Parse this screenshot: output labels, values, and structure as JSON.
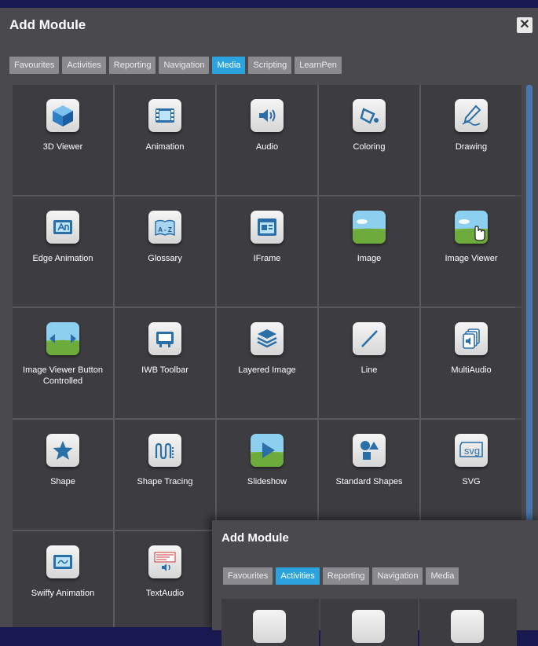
{
  "dialog": {
    "title": "Add Module",
    "close_symbol": "✕",
    "tabs": [
      {
        "label": "Favourites",
        "active": false
      },
      {
        "label": "Activities",
        "active": false
      },
      {
        "label": "Reporting",
        "active": false
      },
      {
        "label": "Navigation",
        "active": false
      },
      {
        "label": "Media",
        "active": true
      },
      {
        "label": "Scripting",
        "active": false
      },
      {
        "label": "LearnPen",
        "active": false
      }
    ],
    "modules": [
      {
        "label": "3D Viewer",
        "icon": "cube-icon"
      },
      {
        "label": "Animation",
        "icon": "film-icon"
      },
      {
        "label": "Audio",
        "icon": "speaker-icon"
      },
      {
        "label": "Coloring",
        "icon": "paint-bucket-icon"
      },
      {
        "label": "Drawing",
        "icon": "pen-icon"
      },
      {
        "label": "Edge Animation",
        "icon": "edge-animation-icon"
      },
      {
        "label": "Glossary",
        "icon": "book-az-icon"
      },
      {
        "label": "IFrame",
        "icon": "iframe-icon"
      },
      {
        "label": "Image",
        "icon": "landscape-icon"
      },
      {
        "label": "Image Viewer",
        "icon": "image-viewer-icon"
      },
      {
        "label": "Image Viewer Button Controlled",
        "icon": "image-arrows-icon"
      },
      {
        "label": "IWB Toolbar",
        "icon": "whiteboard-icon"
      },
      {
        "label": "Layered Image",
        "icon": "layers-icon"
      },
      {
        "label": "Line",
        "icon": "line-icon"
      },
      {
        "label": "MultiAudio",
        "icon": "multi-audio-icon"
      },
      {
        "label": "Shape",
        "icon": "star-icon"
      },
      {
        "label": "Shape Tracing",
        "icon": "tracing-icon"
      },
      {
        "label": "Slideshow",
        "icon": "play-icon"
      },
      {
        "label": "Standard Shapes",
        "icon": "shapes-icon"
      },
      {
        "label": "SVG",
        "icon": "svg-icon"
      },
      {
        "label": "Swiffy Animation",
        "icon": "swiffy-icon"
      },
      {
        "label": "TextAudio",
        "icon": "text-audio-icon"
      }
    ],
    "svg_text": "svg",
    "glossary_text": "A - Z"
  },
  "dialog2": {
    "title": "Add Module",
    "tabs": [
      {
        "label": "Favourites",
        "active": false
      },
      {
        "label": "Activities",
        "active": true
      },
      {
        "label": "Reporting",
        "active": false
      },
      {
        "label": "Navigation",
        "active": false
      },
      {
        "label": "Media",
        "active": false
      }
    ]
  },
  "colors": {
    "background": "#1a1a52",
    "dialog": "#4a4a4e",
    "tile": "#3d3d41",
    "active_tab": "#2aa3de",
    "inactive_tab": "#8b8b8f"
  }
}
